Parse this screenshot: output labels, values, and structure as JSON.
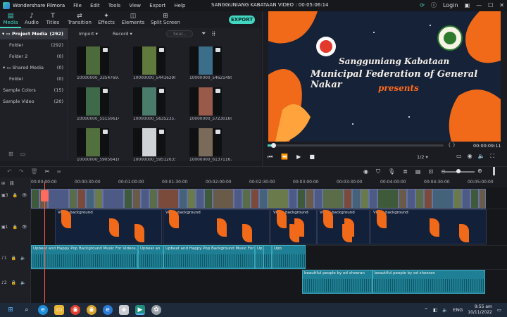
{
  "titlebar": {
    "app_name": "Wondershare Filmora",
    "menu": [
      "File",
      "Edit",
      "Tools",
      "View",
      "Export",
      "Help"
    ],
    "project_title": "SANGGUNIANG KABATAAN VIDEO : 00:05:06:14",
    "login_label": "Login"
  },
  "tabs": [
    {
      "label": "Media",
      "icon": "media-icon"
    },
    {
      "label": "Audio",
      "icon": "audio-icon"
    },
    {
      "label": "Titles",
      "icon": "titles-icon"
    },
    {
      "label": "Transition",
      "icon": "transition-icon"
    },
    {
      "label": "Effects",
      "icon": "effects-icon"
    },
    {
      "label": "Elements",
      "icon": "elements-icon"
    },
    {
      "label": "Split Screen",
      "icon": "split-screen-icon"
    }
  ],
  "export_label": "EXPORT",
  "sidebar": {
    "items": [
      {
        "label": "Project Media",
        "count": "(292)"
      },
      {
        "label": "Folder",
        "count": "(292)"
      },
      {
        "label": "Folder 2",
        "count": "(0)"
      },
      {
        "label": "Shared Media",
        "count": "(0)"
      },
      {
        "label": "Folder",
        "count": "(0)"
      },
      {
        "label": "Sample Colors",
        "count": "(15)"
      },
      {
        "label": "Sample Video",
        "count": "(20)"
      }
    ]
  },
  "library": {
    "import_label": "Import",
    "record_label": "Record",
    "search_placeholder": "Sear...",
    "thumbnails": [
      {
        "label": "10000000_33547697776...",
        "color": "#4d6a3a"
      },
      {
        "label": "10000000_54416298951...",
        "color": "#5f7a3c"
      },
      {
        "label": "10000000_54621499277...",
        "color": "#3b6e8a"
      },
      {
        "label": "10000000_55150614054...",
        "color": "#3f6a4a"
      },
      {
        "label": "10000000_56352357893...",
        "color": "#4b7c6b"
      },
      {
        "label": "10000000_57230160574...",
        "color": "#9a5a4a"
      },
      {
        "label": "10000000_59056416691...",
        "color": "#52703e"
      },
      {
        "label": "10000000_59512635082...",
        "color": "#cfd3d6"
      },
      {
        "label": "10000000_61371167321...",
        "color": "#7a6a5a"
      }
    ]
  },
  "preview": {
    "title_line1": "Sangguniang Kabataan",
    "title_line2": "Municipal Federation of General Nakar",
    "title_line3": "presents",
    "brackets": "{        }",
    "timecode": "00:00:09:11",
    "ratio": "1/2"
  },
  "timeline": {
    "ruler": [
      "00:00:00:00",
      "00:00:30:00",
      "00:01:00:00",
      "00:01:30:00",
      "00:02:00:00",
      "00:02:30:00",
      "00:03:00:00",
      "00:03:30:00",
      "00:04:00:00",
      "00:04:30:00",
      "00:05:00:00"
    ],
    "track_labels": [
      "3",
      "1",
      "1",
      "2"
    ],
    "bg_clip_label": "Video background",
    "audio1": [
      "Upbeat and Happy Pop Background Music For Videos...",
      "Upbeat an",
      "Upbeat and Happy Pop Background Music For Video",
      "Up",
      "Upb"
    ],
    "audio2": [
      "beautiful people by ed sheeran",
      "beautiful people by ed sheeran"
    ]
  },
  "taskbar": {
    "lang": "ENG",
    "time": "9:55 am",
    "date": "10/11/2022"
  },
  "colors": {
    "accent": "#43d7c2",
    "playhead": "#ff5a4f",
    "preview_bg": "#162237",
    "orange": "#f06a19"
  }
}
